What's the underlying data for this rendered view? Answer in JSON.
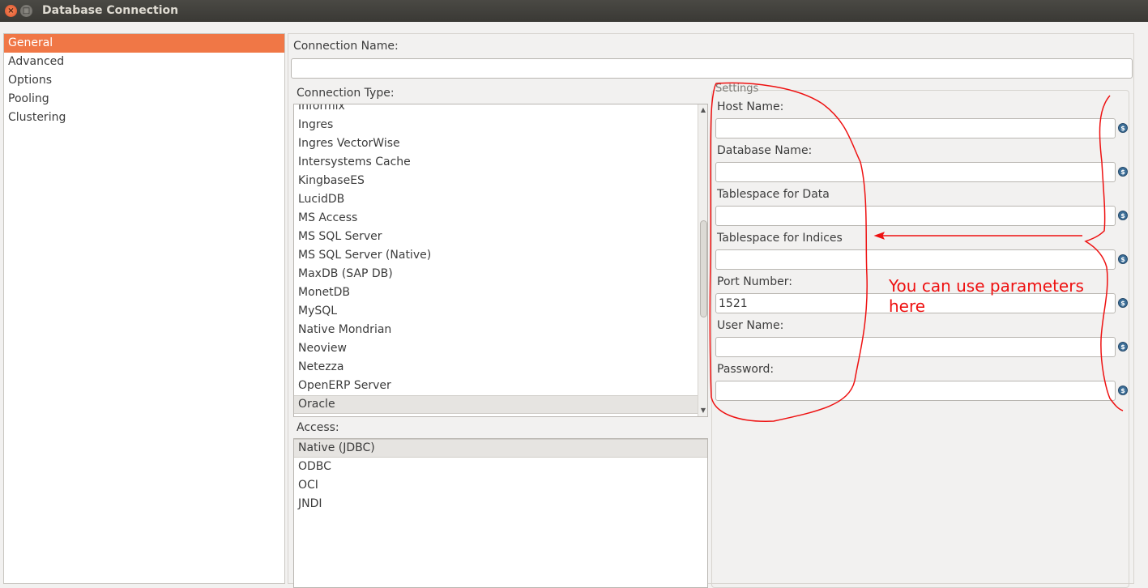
{
  "window": {
    "title": "Database Connection",
    "controls": {
      "close_icon": "close-icon",
      "maximize_icon": "maximize-icon"
    }
  },
  "categories": [
    {
      "label": "General",
      "selected": true
    },
    {
      "label": "Advanced",
      "selected": false
    },
    {
      "label": "Options",
      "selected": false
    },
    {
      "label": "Pooling",
      "selected": false
    },
    {
      "label": "Clustering",
      "selected": false
    }
  ],
  "general": {
    "connection_name_label": "Connection Name:",
    "connection_name_value": "",
    "connection_type_label": "Connection Type:",
    "connection_types": [
      "Informix",
      "Ingres",
      "Ingres VectorWise",
      "Intersystems Cache",
      "KingbaseES",
      "LucidDB",
      "MS Access",
      "MS SQL Server",
      "MS SQL Server (Native)",
      "MaxDB (SAP DB)",
      "MonetDB",
      "MySQL",
      "Native Mondrian",
      "Neoview",
      "Netezza",
      "OpenERP Server",
      "Oracle"
    ],
    "selected_connection_type": "Oracle",
    "access_label": "Access:",
    "access_methods": [
      "Native (JDBC)",
      "ODBC",
      "OCI",
      "JNDI"
    ],
    "selected_access": "Native (JDBC)"
  },
  "settings": {
    "title": "Settings",
    "fields": [
      {
        "label": "Host Name:",
        "value": ""
      },
      {
        "label": "Database Name:",
        "value": ""
      },
      {
        "label": "Tablespace for Data",
        "value": ""
      },
      {
        "label": "Tablespace for Indices",
        "value": ""
      },
      {
        "label": "Port Number:",
        "value": "1521"
      },
      {
        "label": "User Name:",
        "value": ""
      },
      {
        "label": "Password:",
        "value": ""
      }
    ],
    "parameter_icon": "variable-dollar-icon"
  },
  "annotation": {
    "text_line1": "You can use parameters",
    "text_line2": "here",
    "color": "#ee1111"
  },
  "colors": {
    "accent_selected": "#f07746",
    "titlebar": "#3e3d39",
    "panel_bg": "#f2f1f0"
  }
}
